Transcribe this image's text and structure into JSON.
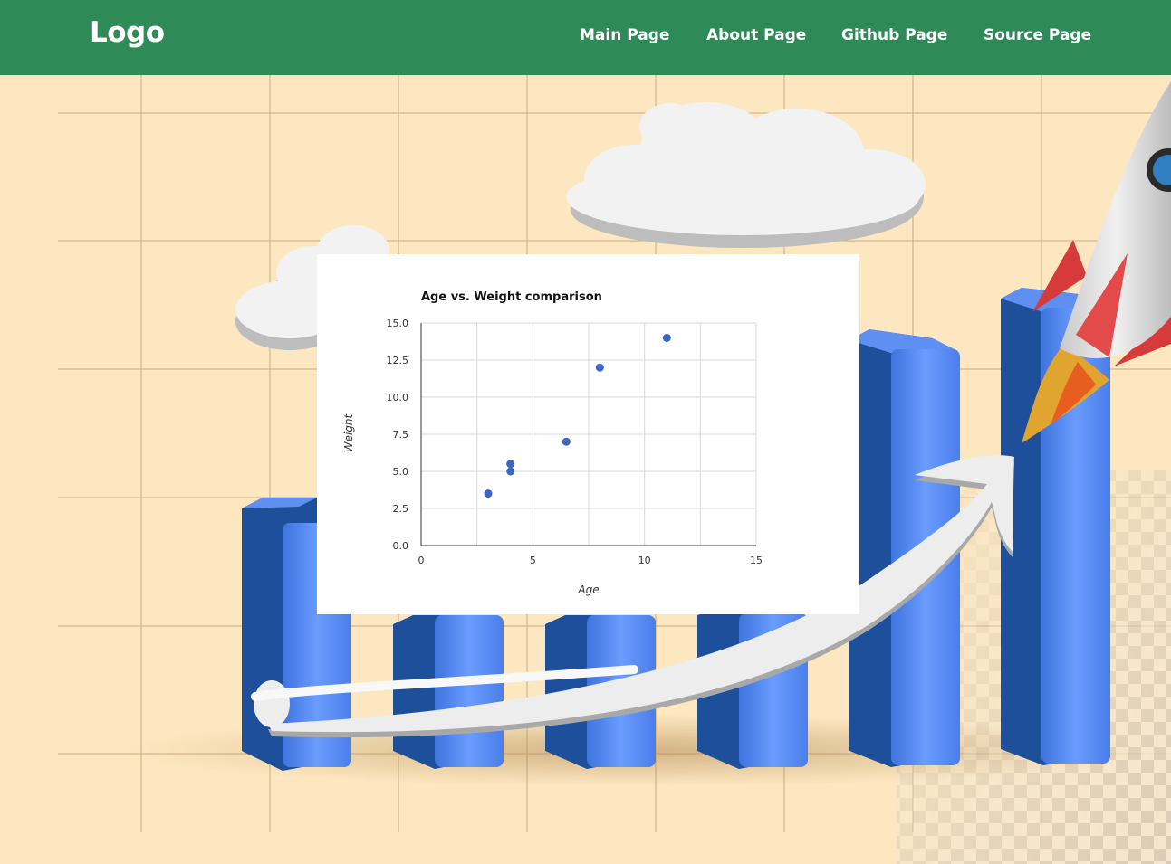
{
  "nav": {
    "logo": "Logo",
    "links": [
      "Main Page",
      "About Page",
      "Github Page",
      "Source Page"
    ]
  },
  "colors": {
    "nav_bg": "#2e8b57",
    "page_bg": "#fde7c0",
    "bar_blue": "#4a7ee8",
    "point": "#3b66c4"
  },
  "chart_data": {
    "type": "scatter",
    "title": "Age vs. Weight comparison",
    "xlabel": "Age",
    "ylabel": "Weight",
    "xlim": [
      0,
      15
    ],
    "ylim": [
      0,
      15
    ],
    "xticks": [
      0,
      5,
      10,
      15
    ],
    "yticks": [
      "0.0",
      "2.5",
      "5.0",
      "7.5",
      "10.0",
      "12.5",
      "15.0"
    ],
    "grid": true,
    "x": [
      3,
      4,
      4,
      6.5,
      8,
      11
    ],
    "y": [
      3.5,
      5.5,
      5,
      7,
      12,
      14
    ]
  }
}
